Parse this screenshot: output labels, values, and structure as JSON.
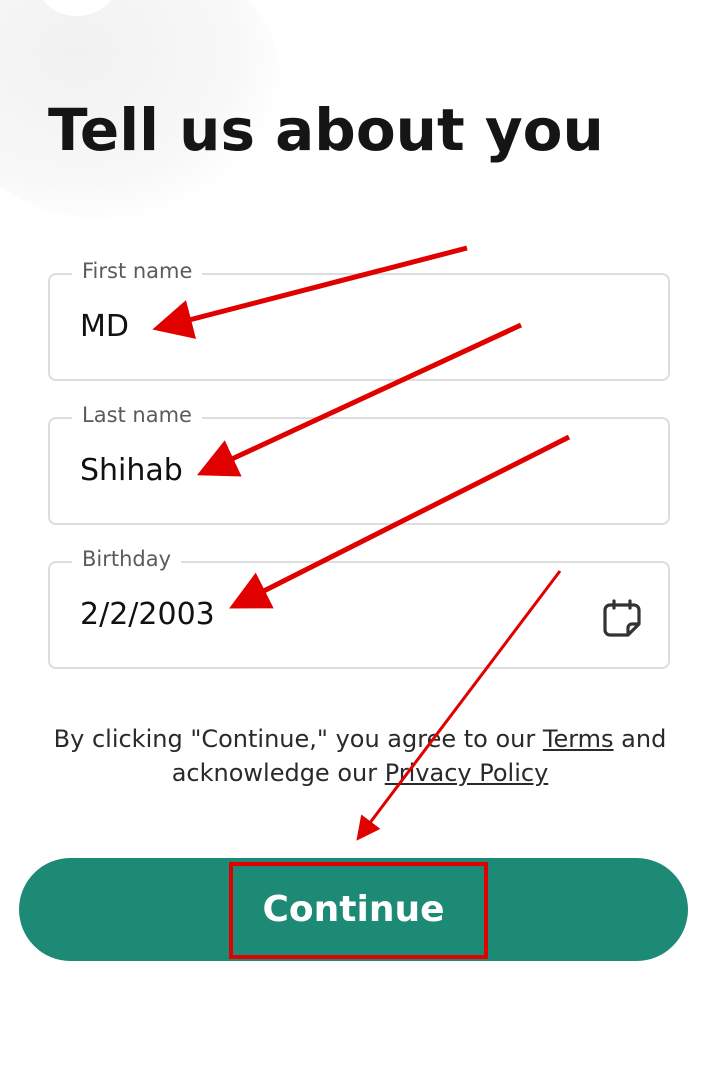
{
  "page": {
    "title": "Tell us about you"
  },
  "form": {
    "first_name": {
      "label": "First name",
      "value": "MD"
    },
    "last_name": {
      "label": "Last name",
      "value": "Shihab"
    },
    "birthday": {
      "label": "Birthday",
      "value": "2/2/2003",
      "icon": "calendar-icon"
    }
  },
  "legal": {
    "prefix": "By clicking \"Continue,\" you agree to our ",
    "terms_link": "Terms",
    "middle": " and acknowledge our ",
    "privacy_link": "Privacy Policy"
  },
  "actions": {
    "continue_label": "Continue"
  },
  "colors": {
    "primary": "#1c8a74",
    "annotation": "#e00000",
    "field_border": "#dddddd"
  }
}
